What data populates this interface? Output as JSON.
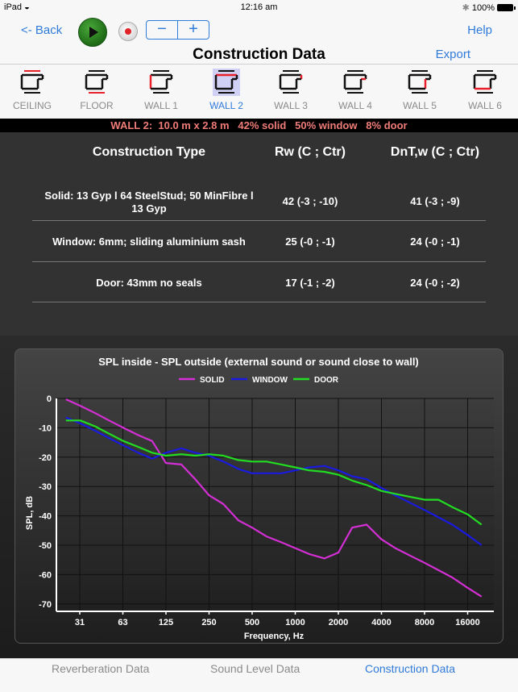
{
  "status_bar": {
    "device": "iPad",
    "time": "12:16 am",
    "battery": "100%"
  },
  "nav": {
    "back_label": "<- Back",
    "help_label": "Help",
    "title": "Construction Data",
    "export_label": "Export",
    "stepper_minus": "−",
    "stepper_plus": "+"
  },
  "surfaces": [
    {
      "label": "CEILING",
      "highlight": "top",
      "selected": false
    },
    {
      "label": "FLOOR",
      "highlight": "bottom",
      "selected": false
    },
    {
      "label": "WALL 1",
      "highlight": "left",
      "selected": false
    },
    {
      "label": "WALL 2",
      "highlight": "back",
      "selected": true
    },
    {
      "label": "WALL 3",
      "highlight": "right-top",
      "selected": false
    },
    {
      "label": "WALL 4",
      "highlight": "step",
      "selected": false
    },
    {
      "label": "WALL 5",
      "highlight": "inner",
      "selected": false
    },
    {
      "label": "WALL 6",
      "highlight": "front",
      "selected": false
    }
  ],
  "info_bar": "WALL 2:  10.0 m x 2.8 m   42% solid   50% window   8% door",
  "table": {
    "headers": [
      "Construction Type",
      "Rw (C ; Ctr)",
      "DnT,w (C ; Ctr)"
    ],
    "rows": [
      {
        "type_line1": "Solid: 13 Gyp l 64 SteelStud; 50 MinFibre l",
        "type_line2": "13 Gyp",
        "rw": "42 (-3 ; -10)",
        "dntw": "41 (-3 ; -9)"
      },
      {
        "type_line1": "Window: 6mm; sliding aluminium sash",
        "type_line2": "",
        "rw": "25 (-0 ; -1)",
        "dntw": "24 (-0 ; -1)"
      },
      {
        "type_line1": "Door: 43mm no seals",
        "type_line2": "",
        "rw": "17 (-1 ; -2)",
        "dntw": "24 (-0 ; -2)"
      }
    ]
  },
  "chart_data": {
    "type": "line",
    "title": "SPL inside - SPL outside (external sound or sound close to wall)",
    "xlabel": "Frequency, Hz",
    "ylabel": "SPL, dB",
    "x_scale": "log",
    "x_ticks": [
      "31",
      "63",
      "125",
      "250",
      "500",
      "1000",
      "2000",
      "4000",
      "8000",
      "16000"
    ],
    "y_ticks": [
      0,
      -10,
      -20,
      -30,
      -40,
      -50,
      -60,
      -70
    ],
    "ylim": [
      -74,
      0
    ],
    "grid": true,
    "legend_position": "top-center",
    "x": [
      25,
      31.5,
      40,
      50,
      63,
      80,
      100,
      125,
      160,
      200,
      250,
      315,
      400,
      500,
      630,
      800,
      1000,
      1250,
      1600,
      2000,
      2500,
      3150,
      4000,
      5000,
      6300,
      8000,
      10000,
      12500,
      16000,
      20000
    ],
    "series": [
      {
        "name": "SOLID",
        "color": "#d42fd4",
        "values": [
          -0.3,
          -2.5,
          -5,
          -7.5,
          -10,
          -12.5,
          -14.5,
          -22,
          -22.5,
          -27.5,
          -33,
          -36,
          -41.5,
          -44,
          -47,
          -49,
          -51,
          -53,
          -54.5,
          -52.5,
          -44,
          -43,
          -48,
          -51,
          -53.5,
          -56,
          -58.5,
          -61,
          -64.5,
          -67.5
        ]
      },
      {
        "name": "WINDOW",
        "color": "#1a1ae0",
        "values": [
          -6.5,
          -8.5,
          -11,
          -13.5,
          -16,
          -18.5,
          -20.5,
          -18.5,
          -17,
          -18.5,
          -19.5,
          -21.5,
          -24,
          -25.5,
          -25.5,
          -25.5,
          -24.5,
          -23.5,
          -23,
          -24.5,
          -26.5,
          -27.5,
          -30.5,
          -33,
          -35.5,
          -38,
          -40.5,
          -43,
          -46.5,
          -50
        ]
      },
      {
        "name": "DOOR",
        "color": "#22dd22",
        "values": [
          -7.5,
          -7.5,
          -9.5,
          -12,
          -14.5,
          -16.5,
          -18.5,
          -19.5,
          -19,
          -19.5,
          -19,
          -19.5,
          -21,
          -21.5,
          -21.5,
          -22.5,
          -23.5,
          -24.5,
          -25,
          -26,
          -28,
          -29.5,
          -31.5,
          -32.5,
          -33.5,
          -34.5,
          -34.5,
          -37,
          -39.5,
          -43
        ]
      }
    ]
  },
  "tabs": [
    {
      "label": "Reverberation Data",
      "active": false
    },
    {
      "label": "Sound Level Data",
      "active": false
    },
    {
      "label": "Construction Data",
      "active": true
    }
  ]
}
